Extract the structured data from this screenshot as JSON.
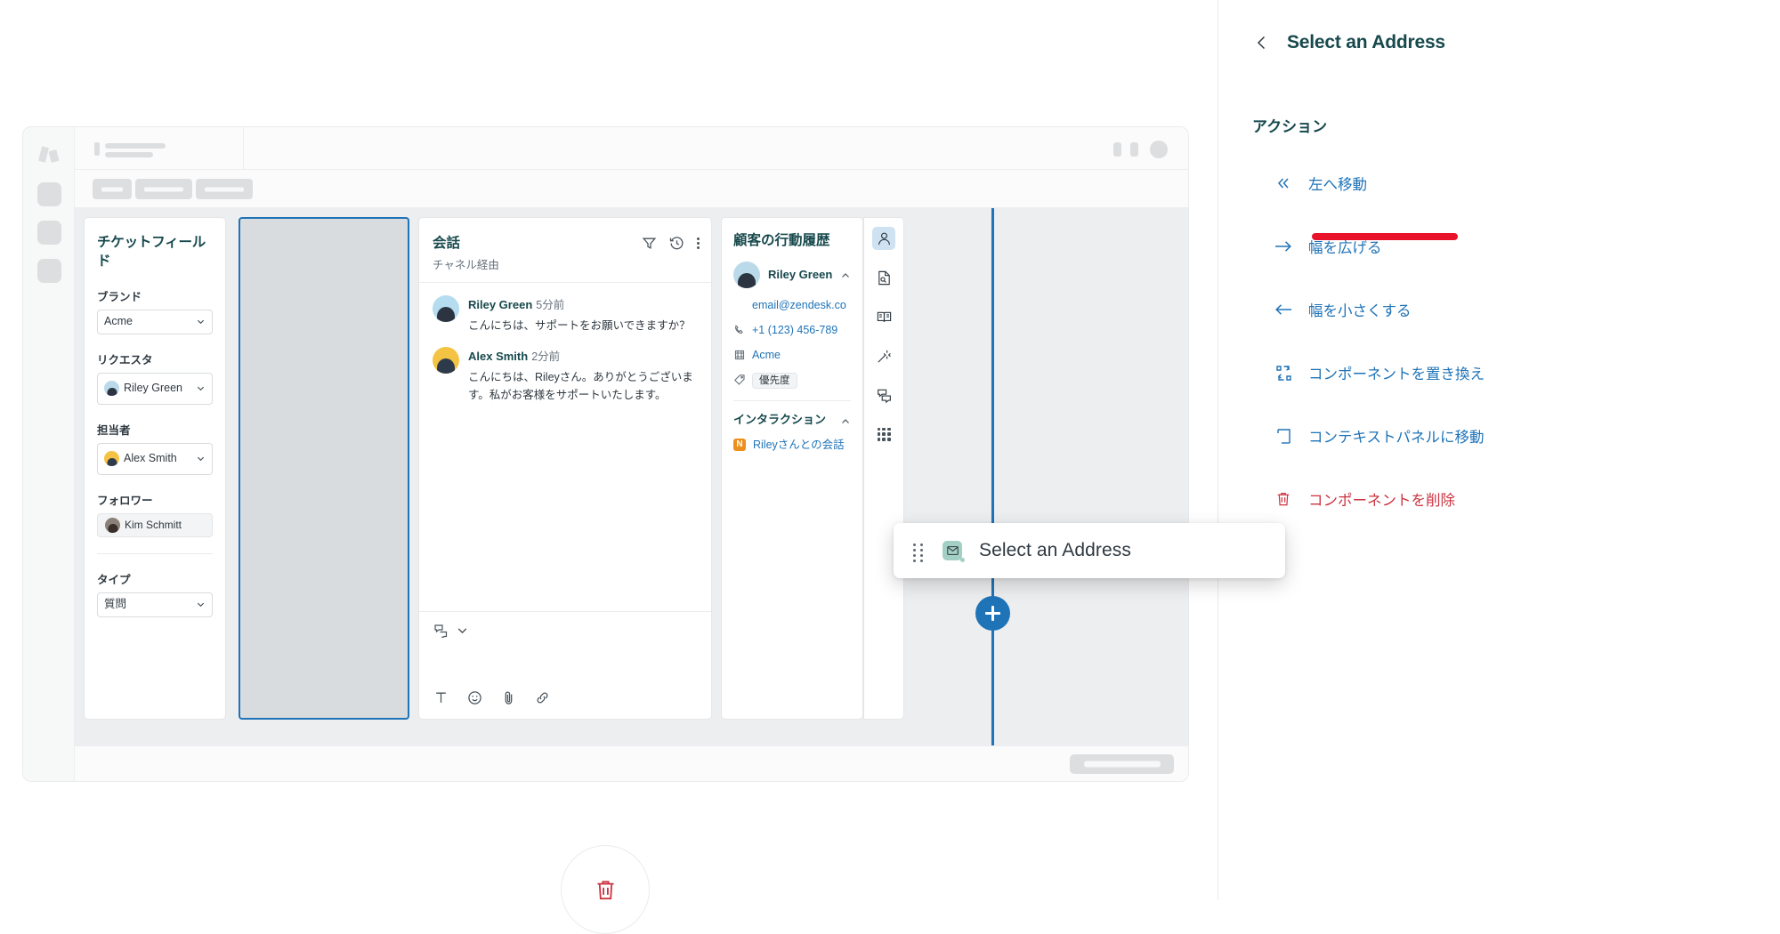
{
  "right_panel": {
    "back_icon": "chevron-left-icon",
    "title": "Select an Address",
    "section_label": "アクション",
    "actions": [
      {
        "icon": "double-chevron-left-icon",
        "label": "左へ移動",
        "color": "#1f73b7",
        "highlighted": true
      },
      {
        "icon": "arrow-right-icon",
        "label": "幅を広げる",
        "color": "#1f73b7"
      },
      {
        "icon": "arrow-left-icon",
        "label": "幅を小さくする",
        "color": "#1f73b7"
      },
      {
        "icon": "swap-component-icon",
        "label": "コンポーネントを置き換え",
        "color": "#1f73b7"
      },
      {
        "icon": "context-panel-icon",
        "label": "コンテキストパネルに移動",
        "color": "#1f73b7"
      },
      {
        "icon": "trash-icon",
        "label": "コンポーネントを削除",
        "color": "#cc3340"
      }
    ]
  },
  "drag_card": {
    "grip_icon": "drag-handle-icon",
    "app_icon": "mail-icon",
    "label": "Select an Address"
  },
  "trash_zone": {
    "icon": "trash-icon"
  },
  "app": {
    "nav_rail": {
      "logo_icon": "zendesk-logo-icon",
      "items": [
        "nav-placeholder-1",
        "nav-placeholder-2",
        "nav-placeholder-3"
      ]
    },
    "fields_panel": {
      "title": "チケットフィールド",
      "fields": [
        {
          "label": "ブランド",
          "value": "Acme",
          "control": "select"
        },
        {
          "label": "リクエスタ",
          "value": "Riley Green",
          "control": "select",
          "avatar": "riley-avatar"
        },
        {
          "label": "担当者",
          "value": "Alex Smith",
          "control": "select",
          "avatar": "alex-avatar"
        },
        {
          "label": "フォロワー",
          "value": "Kim Schmitt",
          "control": "pill",
          "avatar": "kim-avatar"
        },
        {
          "label": "タイプ",
          "value": "質問",
          "control": "select"
        }
      ]
    },
    "conversation_panel": {
      "title": "会話",
      "subtitle": "チャネル経由",
      "actions": [
        "filter-icon",
        "history-icon",
        "more-options-icon"
      ],
      "messages": [
        {
          "author": "Riley Green",
          "time": "5分前",
          "text": "こんにちは、サポートをお願いできますか？",
          "avatar": "riley-avatar"
        },
        {
          "author": "Alex Smith",
          "time": "2分前",
          "text": "こんにちは、Rileyさん。ありがとうございます。私がお客様をサポートいたします。",
          "avatar": "alex-avatar"
        }
      ],
      "composer": {
        "channel_icon": "reply-channel-icon",
        "channel_chevron": "chevron-down-icon",
        "tools": [
          "text-format-icon",
          "emoji-icon",
          "attachment-icon",
          "link-icon"
        ]
      }
    },
    "customer_panel": {
      "title": "顧客の行動履歴",
      "person": {
        "name": "Riley Green",
        "avatar": "riley-avatar",
        "collapse_icon": "chevron-up-icon"
      },
      "details": [
        {
          "icon": "email-icon",
          "value": "email@zendesk.co"
        },
        {
          "icon": "phone-icon",
          "value": "+1 (123) 456-789"
        },
        {
          "icon": "organization-icon",
          "value": "Acme"
        },
        {
          "icon": "tag-icon",
          "value": "優先度"
        }
      ],
      "interactions": {
        "title": "インタラクション",
        "collapse_icon": "chevron-up-icon",
        "items": [
          {
            "badge": "N",
            "label": "Rileyさんとの会話"
          }
        ]
      }
    },
    "icon_rail": [
      {
        "icon": "user-icon",
        "active": true
      },
      {
        "icon": "document-search-icon",
        "active": false
      },
      {
        "icon": "knowledge-book-icon",
        "active": false
      },
      {
        "icon": "magic-wand-icon",
        "active": false
      },
      {
        "icon": "conversation-icon",
        "active": false
      },
      {
        "icon": "apps-grid-icon",
        "active": false
      }
    ],
    "add_button": {
      "icon": "plus-icon",
      "color": "#1f73b7"
    }
  }
}
